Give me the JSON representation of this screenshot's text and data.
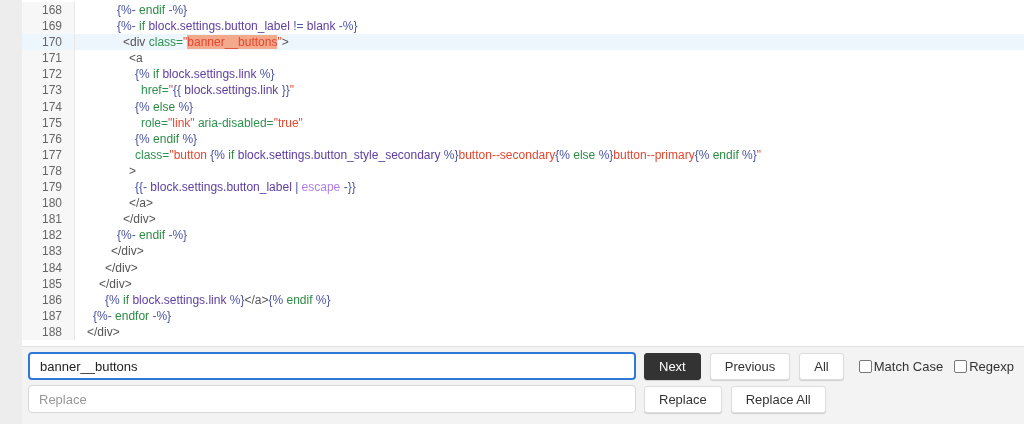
{
  "editor": {
    "lines": [
      {
        "number": "168",
        "current": false,
        "tokens": [
          {
            "text": "     {%-",
            "kind": "delim"
          },
          {
            "text": " endif",
            "kind": "keyword"
          },
          {
            "text": " -%}",
            "kind": "delim"
          }
        ]
      },
      {
        "number": "169",
        "current": false,
        "tokens": [
          {
            "text": "     {%-",
            "kind": "delim"
          },
          {
            "text": " if",
            "kind": "keyword"
          },
          {
            "text": " block.settings.button_label",
            "kind": "var"
          },
          {
            "text": " != ",
            "kind": "delim"
          },
          {
            "text": "blank",
            "kind": "var"
          },
          {
            "text": " -%}",
            "kind": "delim"
          }
        ]
      },
      {
        "number": "170",
        "current": true,
        "tokens": [
          {
            "text": "      <div",
            "kind": "tag"
          },
          {
            "text": " class=",
            "kind": "attr"
          },
          {
            "text": "\"",
            "kind": "string"
          },
          {
            "text": "banner__buttons",
            "kind": "match"
          },
          {
            "text": "\"",
            "kind": "string"
          },
          {
            "text": ">",
            "kind": "tag"
          }
        ]
      },
      {
        "number": "171",
        "current": false,
        "tokens": [
          {
            "text": "       <a",
            "kind": "tag"
          }
        ]
      },
      {
        "number": "172",
        "current": false,
        "tokens": [
          {
            "text": "        {%",
            "kind": "delim"
          },
          {
            "text": " if",
            "kind": "keyword"
          },
          {
            "text": " block.settings.link",
            "kind": "var"
          },
          {
            "text": " %}",
            "kind": "delim"
          }
        ]
      },
      {
        "number": "173",
        "current": false,
        "tokens": [
          {
            "text": "         href=",
            "kind": "attr"
          },
          {
            "text": "\"",
            "kind": "string"
          },
          {
            "text": "{{",
            "kind": "delim"
          },
          {
            "text": " block.settings.link",
            "kind": "var"
          },
          {
            "text": " }}",
            "kind": "delim"
          },
          {
            "text": "\"",
            "kind": "string"
          }
        ]
      },
      {
        "number": "174",
        "current": false,
        "tokens": [
          {
            "text": "        {%",
            "kind": "delim"
          },
          {
            "text": " else",
            "kind": "keyword"
          },
          {
            "text": " %}",
            "kind": "delim"
          }
        ]
      },
      {
        "number": "175",
        "current": false,
        "tokens": [
          {
            "text": "         role=",
            "kind": "attr"
          },
          {
            "text": "\"link\"",
            "kind": "string"
          },
          {
            "text": " aria-disabled=",
            "kind": "attr"
          },
          {
            "text": "\"true\"",
            "kind": "string"
          }
        ]
      },
      {
        "number": "176",
        "current": false,
        "tokens": [
          {
            "text": "        {%",
            "kind": "delim"
          },
          {
            "text": " endif",
            "kind": "keyword"
          },
          {
            "text": " %}",
            "kind": "delim"
          }
        ]
      },
      {
        "number": "177",
        "current": false,
        "tokens": [
          {
            "text": "        class=",
            "kind": "attr"
          },
          {
            "text": "\"button ",
            "kind": "string"
          },
          {
            "text": "{%",
            "kind": "delim"
          },
          {
            "text": " if",
            "kind": "keyword"
          },
          {
            "text": " block.settings.button_style_secondary",
            "kind": "var"
          },
          {
            "text": " %}",
            "kind": "delim"
          },
          {
            "text": "button--secondary",
            "kind": "string"
          },
          {
            "text": "{%",
            "kind": "delim"
          },
          {
            "text": " else",
            "kind": "keyword"
          },
          {
            "text": " %}",
            "kind": "delim"
          },
          {
            "text": "button--primary",
            "kind": "string"
          },
          {
            "text": "{%",
            "kind": "delim"
          },
          {
            "text": " endif",
            "kind": "keyword"
          },
          {
            "text": " %}",
            "kind": "delim"
          },
          {
            "text": "\"",
            "kind": "string"
          }
        ]
      },
      {
        "number": "178",
        "current": false,
        "tokens": [
          {
            "text": "       >",
            "kind": "tag"
          }
        ]
      },
      {
        "number": "179",
        "current": false,
        "tokens": [
          {
            "text": "        {{-",
            "kind": "delim"
          },
          {
            "text": " block.settings.button_label",
            "kind": "var"
          },
          {
            "text": " | ",
            "kind": "delim"
          },
          {
            "text": "escape",
            "kind": "filter"
          },
          {
            "text": " -}}",
            "kind": "delim"
          }
        ]
      },
      {
        "number": "180",
        "current": false,
        "tokens": [
          {
            "text": "       </a>",
            "kind": "tag"
          }
        ]
      },
      {
        "number": "181",
        "current": false,
        "tokens": [
          {
            "text": "      </div>",
            "kind": "tag"
          }
        ]
      },
      {
        "number": "182",
        "current": false,
        "tokens": [
          {
            "text": "     {%-",
            "kind": "delim"
          },
          {
            "text": " endif",
            "kind": "keyword"
          },
          {
            "text": " -%}",
            "kind": "delim"
          }
        ]
      },
      {
        "number": "183",
        "current": false,
        "tokens": [
          {
            "text": "    </div>",
            "kind": "tag"
          }
        ]
      },
      {
        "number": "184",
        "current": false,
        "tokens": [
          {
            "text": "   </div>",
            "kind": "tag"
          }
        ]
      },
      {
        "number": "185",
        "current": false,
        "tokens": [
          {
            "text": "  </div>",
            "kind": "tag"
          }
        ]
      },
      {
        "number": "186",
        "current": false,
        "tokens": [
          {
            "text": "   {%",
            "kind": "delim"
          },
          {
            "text": " if",
            "kind": "keyword"
          },
          {
            "text": " block.settings.link",
            "kind": "var"
          },
          {
            "text": " %}",
            "kind": "delim"
          },
          {
            "text": "</a>",
            "kind": "tag"
          },
          {
            "text": "{%",
            "kind": "delim"
          },
          {
            "text": " endif",
            "kind": "keyword"
          },
          {
            "text": " %}",
            "kind": "delim"
          }
        ]
      },
      {
        "number": "187",
        "current": false,
        "tokens": [
          {
            "text": " {%-",
            "kind": "delim"
          },
          {
            "text": " endfor",
            "kind": "keyword"
          },
          {
            "text": " -%}",
            "kind": "delim"
          }
        ]
      },
      {
        "number": "188",
        "current": false,
        "tokens": [
          {
            "text": "</div>",
            "kind": "tag"
          }
        ]
      }
    ]
  },
  "search_panel": {
    "find": {
      "value": "banner__buttons"
    },
    "replace": {
      "placeholder": "Replace"
    },
    "find_buttons": [
      {
        "label": "Next",
        "kind": "primary"
      },
      {
        "label": "Previous",
        "kind": "default"
      },
      {
        "label": "All",
        "kind": "default"
      }
    ],
    "options": [
      {
        "label": "Match Case",
        "checked": false
      },
      {
        "label": "Regexp",
        "checked": false
      }
    ],
    "replace_buttons": [
      {
        "label": "Replace",
        "kind": "default"
      },
      {
        "label": "Replace All",
        "kind": "default"
      }
    ]
  }
}
